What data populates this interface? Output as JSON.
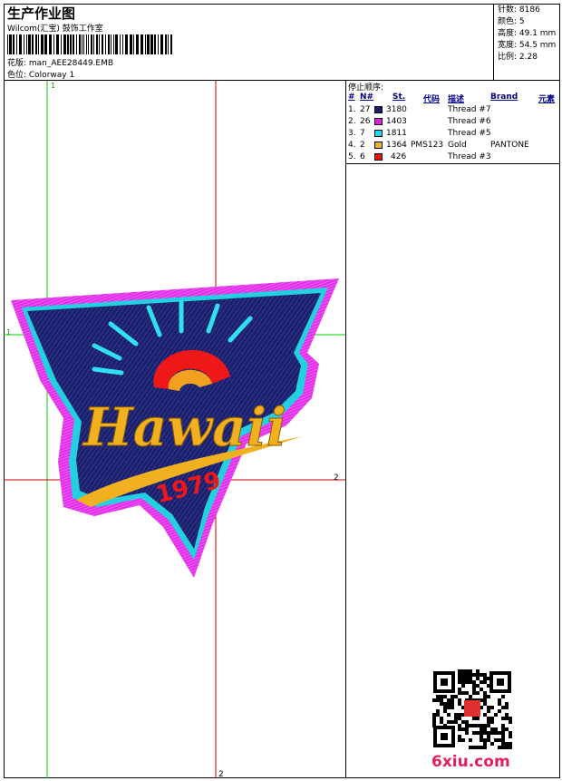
{
  "header": {
    "title": "生产作业图",
    "company": "Wilcom(汇宝) 鼓饰工作室",
    "design_label": "花版: man_AEE28449.EMB",
    "colorway_label": "色位: Colorway 1"
  },
  "stats": [
    "针数: 8186",
    "颜色: 5",
    "高度: 49.1 mm",
    "宽度: 54.5 mm",
    "比例: 2.28"
  ],
  "guides": {
    "h1": "1",
    "h2": "2",
    "v1": "1",
    "v2": "2"
  },
  "stop_sequence": {
    "caption": "停止顺序:",
    "headers": [
      "#",
      "N#",
      "St.",
      "代码",
      "描述",
      "Brand",
      "元素"
    ],
    "rows": [
      {
        "idx": "1.",
        "n": "27",
        "st": "3180",
        "code": "",
        "desc": "Thread #7",
        "brand": "",
        "color": "#1a1a6e"
      },
      {
        "idx": "2.",
        "n": "26",
        "st": "1403",
        "code": "",
        "desc": "Thread #6",
        "brand": "",
        "color": "#e020e0"
      },
      {
        "idx": "3.",
        "n": "7",
        "st": "1811",
        "code": "",
        "desc": "Thread #5",
        "brand": "",
        "color": "#20d8e8"
      },
      {
        "idx": "4.",
        "n": "2",
        "st": "1364",
        "code": "PMS123",
        "desc": "Gold",
        "brand": "PANTONE",
        "color": "#f0b020"
      },
      {
        "idx": "5.",
        "n": "6",
        "st": "426",
        "code": "",
        "desc": "Thread #3",
        "brand": "",
        "color": "#e81010"
      }
    ]
  },
  "patch": {
    "word": "Hawaii",
    "year": "1979"
  },
  "watermark": {
    "site": "6xiu.com"
  }
}
